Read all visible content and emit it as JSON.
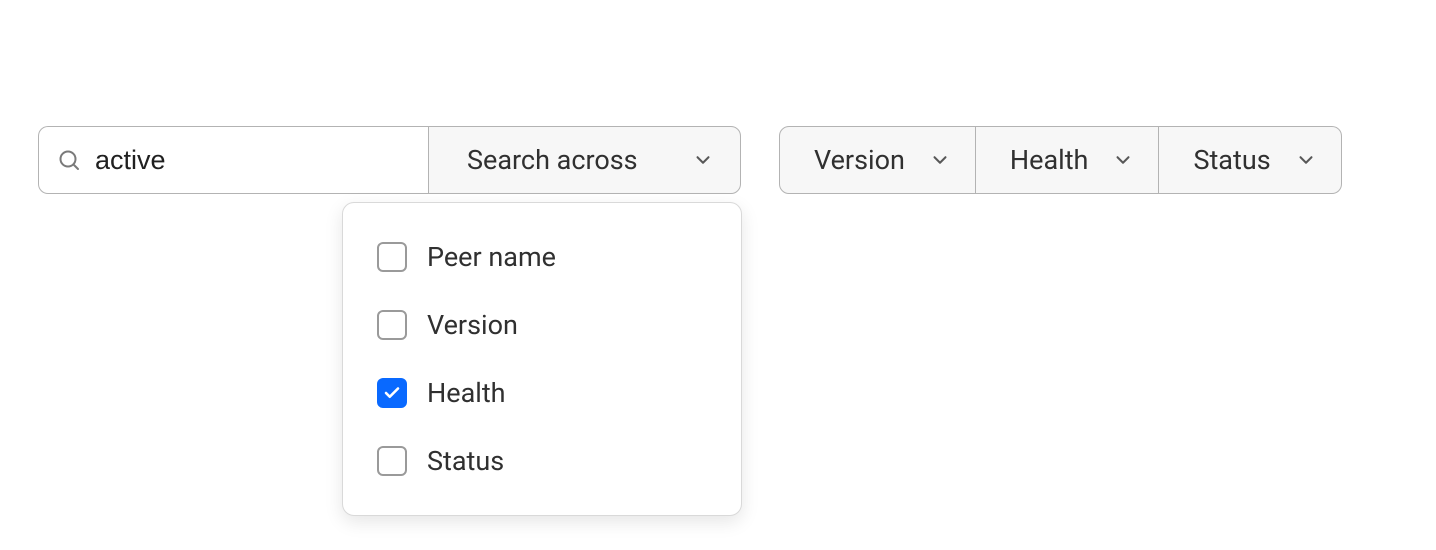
{
  "search": {
    "value": "active",
    "across_label": "Search across",
    "options": [
      {
        "label": "Peer name",
        "checked": false
      },
      {
        "label": "Version",
        "checked": false
      },
      {
        "label": "Health",
        "checked": true
      },
      {
        "label": "Status",
        "checked": false
      }
    ]
  },
  "filters": [
    {
      "label": "Version"
    },
    {
      "label": "Health"
    },
    {
      "label": "Status"
    }
  ]
}
